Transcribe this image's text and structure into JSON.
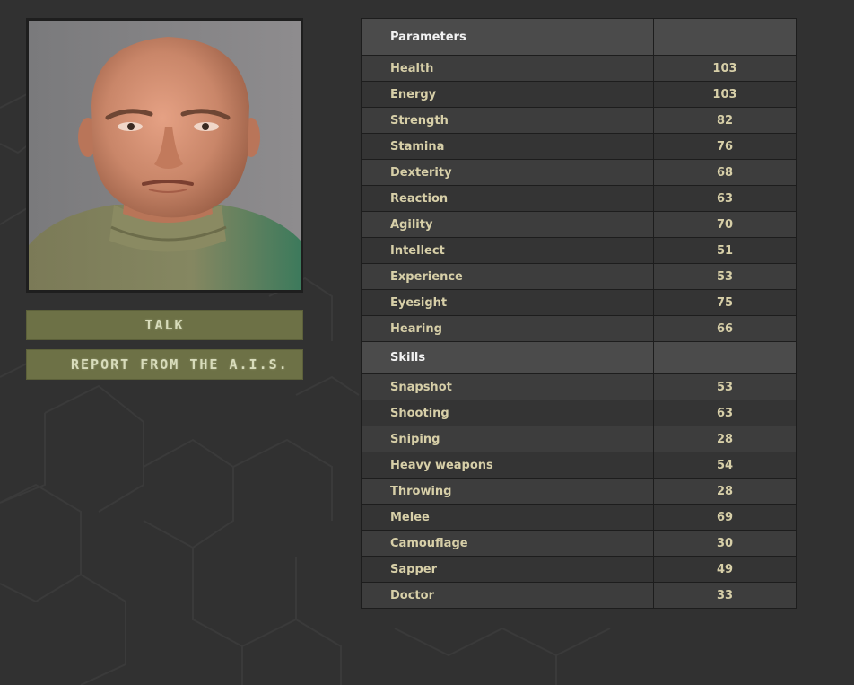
{
  "theme": {
    "background": "#313131",
    "button_bg": "#6d7146",
    "button_text": "#d8dcbb",
    "header_bg": "#4b4b4b",
    "row_text": "#d7cfa8"
  },
  "character": {
    "portrait_icon": "character-portrait"
  },
  "actions": {
    "talk_label": "TALK",
    "report_label": "REPORT FROM THE A.I.S."
  },
  "parameters": {
    "header": "Parameters",
    "header_value": "",
    "rows": [
      {
        "name": "Health",
        "value": "103"
      },
      {
        "name": "Energy",
        "value": "103"
      },
      {
        "name": "Strength",
        "value": "82"
      },
      {
        "name": "Stamina",
        "value": "76"
      },
      {
        "name": "Dexterity",
        "value": "68"
      },
      {
        "name": "Reaction",
        "value": "63"
      },
      {
        "name": "Agility",
        "value": "70"
      },
      {
        "name": "Intellect",
        "value": "51"
      },
      {
        "name": "Experience",
        "value": "53"
      },
      {
        "name": "Eyesight",
        "value": "75"
      },
      {
        "name": "Hearing",
        "value": "66"
      }
    ]
  },
  "skills": {
    "header": "Skills",
    "header_value": "",
    "rows": [
      {
        "name": "Snapshot",
        "value": "53"
      },
      {
        "name": "Shooting",
        "value": "63"
      },
      {
        "name": "Sniping",
        "value": "28"
      },
      {
        "name": "Heavy weapons",
        "value": "54"
      },
      {
        "name": "Throwing",
        "value": "28"
      },
      {
        "name": "Melee",
        "value": "69"
      },
      {
        "name": "Camouflage",
        "value": "30"
      },
      {
        "name": "Sapper",
        "value": "49"
      },
      {
        "name": "Doctor",
        "value": "33"
      }
    ]
  }
}
